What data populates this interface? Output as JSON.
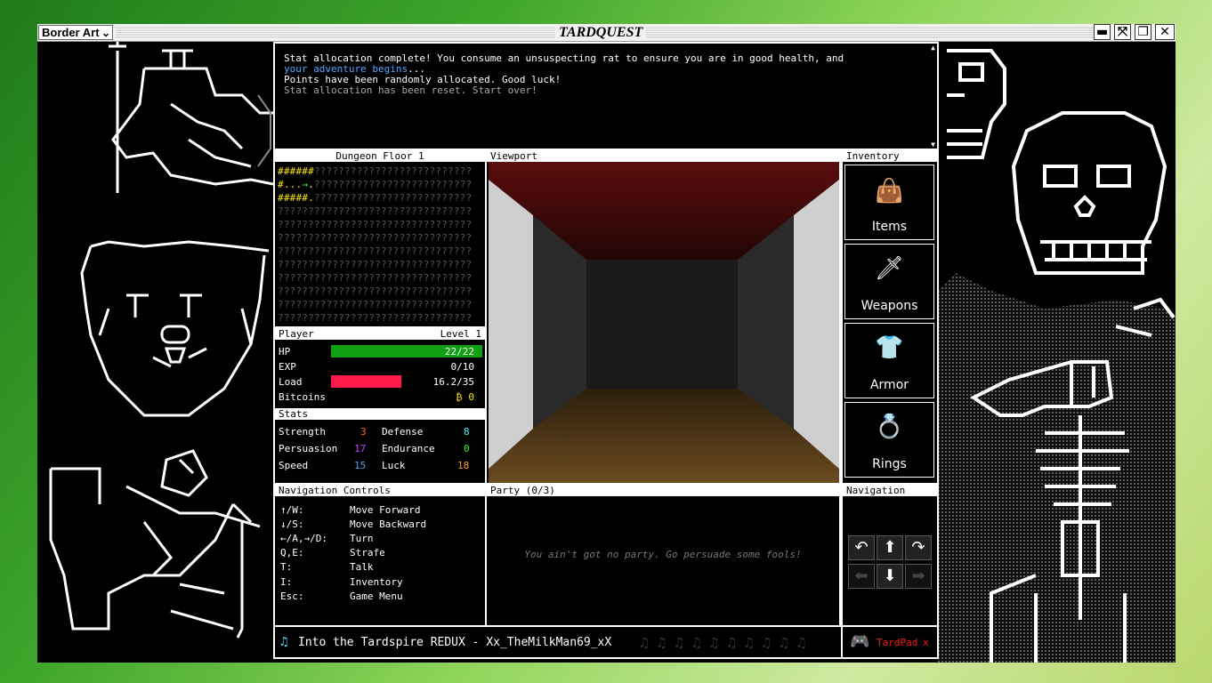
{
  "app": {
    "title": "TARDQUEST",
    "border_art_label": "Border Art"
  },
  "log": {
    "line1_a": "Stat allocation complete! You consume an unsuspecting rat to ensure you are in good health, and ",
    "line1_b": "your adventure begins",
    "line1_c": "...",
    "line2": "Points have been randomly allocated. Good luck!",
    "line3": "Stat allocation has been reset. Start over!"
  },
  "map": {
    "title": "Dungeon Floor 1",
    "row1_a": "######",
    "row1_b": "??????????????????????????",
    "row2_a": "#...",
    "row2_b": "→",
    "row2_c": ".",
    "row2_d": "??????????????????????????",
    "row3_a": "#####.",
    "row3_b": "??????????????????????????",
    "rest": "????????????????????????????????\n????????????????????????????????\n????????????????????????????????\n????????????????????????????????\n????????????????????????????????\n????????????????????????????????\n????????????????????????????????\n????????????????????????????????\n????????????????????????????????"
  },
  "viewport": {
    "title": "Viewport"
  },
  "inventory": {
    "title": "Inventory",
    "items": [
      {
        "label": "Items",
        "icon": "bag-icon"
      },
      {
        "label": "Weapons",
        "icon": "sword-icon"
      },
      {
        "label": "Armor",
        "icon": "armor-icon"
      },
      {
        "label": "Rings",
        "icon": "ring-icon"
      }
    ]
  },
  "player": {
    "title": "Player",
    "level": "Level 1",
    "hp_label": "HP",
    "hp_value": "22/22",
    "hp_fraction": 1.0,
    "exp_label": "EXP",
    "exp_value": "0/10",
    "load_label": "Load",
    "load_value": "16.2/35",
    "load_fraction": 0.463,
    "bitcoins_label": "Bitcoins",
    "bitcoins_value": "₿ 0",
    "hp_color": "#11a012",
    "load_color": "#ff1a4a"
  },
  "stats": {
    "title": "Stats",
    "strength_label": "Strength",
    "strength": "3",
    "defense_label": "Defense",
    "defense": "8",
    "persuasion_label": "Persuasion",
    "persuasion": "17",
    "endurance_label": "Endurance",
    "endurance": "0",
    "speed_label": "Speed",
    "speed": "15",
    "luck_label": "Luck",
    "luck": "18"
  },
  "controls": {
    "title": "Navigation Controls",
    "rows": [
      {
        "key": "↑/W:",
        "action": "Move Forward"
      },
      {
        "key": "↓/S:",
        "action": "Move Backward"
      },
      {
        "key": "←/A,→/D:",
        "action": "Turn"
      },
      {
        "key": "Q,E:",
        "action": "Strafe"
      },
      {
        "key": "T:",
        "action": "Talk"
      },
      {
        "key": "I:",
        "action": "Inventory"
      },
      {
        "key": "Esc:",
        "action": "Game Menu"
      }
    ]
  },
  "party": {
    "title": "Party (0/3)",
    "empty": "You ain't got no party. Go persuade some fools!"
  },
  "navigation": {
    "title": "Navigation"
  },
  "music": {
    "note": "♫",
    "track": "Into the Tardspire REDUX - Xx_TheMilkMan69_xX"
  },
  "tardpad": {
    "label": "TardPad",
    "close": "x"
  }
}
